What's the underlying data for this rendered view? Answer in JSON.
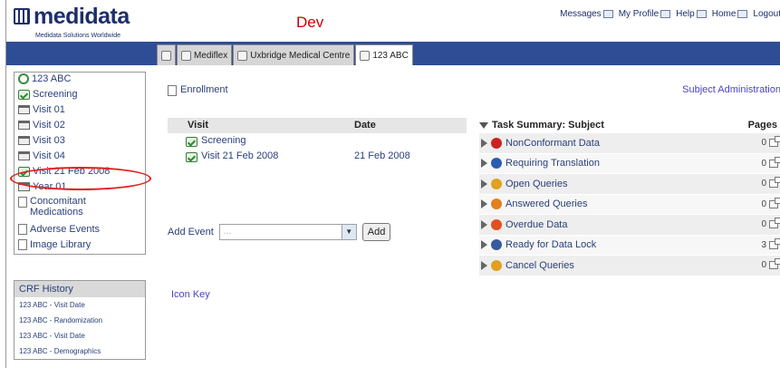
{
  "header": {
    "logo_text": "medidata",
    "logo_tagline": "Medidata Solutions Worldwide",
    "environment": "Dev",
    "links": [
      {
        "label": "Messages",
        "icon": "mail-icon"
      },
      {
        "label": "My Profile",
        "icon": "profile-icon"
      },
      {
        "label": "Help",
        "icon": "help-icon"
      },
      {
        "label": "Home",
        "icon": "home-icon"
      },
      {
        "label": "Logout",
        "icon": "logout-icon"
      }
    ]
  },
  "tabs": [
    {
      "label": "",
      "icon": "home-icon"
    },
    {
      "label": "Mediflex",
      "icon": "study-icon"
    },
    {
      "label": "Uxbridge Medical Centre",
      "icon": "site-icon"
    },
    {
      "label": "123 ABC",
      "icon": "subject-icon",
      "active": true
    }
  ],
  "sidebar": {
    "subject": "123 ABC",
    "items": [
      {
        "label": "Screening",
        "icon": "visit-complete-icon"
      },
      {
        "label": "Visit 01",
        "icon": "folder-icon"
      },
      {
        "label": "Visit 02",
        "icon": "folder-icon"
      },
      {
        "label": "Visit 03",
        "icon": "folder-icon"
      },
      {
        "label": "Visit 04",
        "icon": "folder-icon"
      },
      {
        "label": "Visit 21 Feb 2008",
        "icon": "visit-complete-icon",
        "highlighted": true
      },
      {
        "label": "Year 01",
        "icon": "folder-icon"
      },
      {
        "label": "Concomitant Medications",
        "icon": "document-icon"
      },
      {
        "label": "Adverse Events",
        "icon": "document-icon"
      },
      {
        "label": "Image Library",
        "icon": "document-icon"
      }
    ]
  },
  "crf_history": {
    "title": "CRF History",
    "items": [
      "123 ABC - Visit Date",
      "123 ABC - Randomization",
      "123 ABC - Visit Date",
      "123 ABC - Demographics"
    ]
  },
  "main": {
    "enrollment_link": "Enrollment",
    "subject_admin_link": "Subject Administration",
    "visit_table": {
      "headers": [
        "Visit",
        "Date"
      ],
      "rows": [
        {
          "visit": "Screening",
          "date": ""
        },
        {
          "visit": "Visit 21 Feb 2008",
          "date": "21 Feb 2008"
        }
      ]
    },
    "add_event_label": "Add Event",
    "add_event_placeholder": "...",
    "add_button": "Add",
    "icon_key_link": "Icon Key"
  },
  "task_summary": {
    "title": "Task Summary: Subject",
    "pages_header": "Pages",
    "rows": [
      {
        "label": "NonConformant Data",
        "count": "0",
        "icon": "warning-icon",
        "color": "#cc2222"
      },
      {
        "label": "Requiring Translation",
        "count": "0",
        "icon": "translation-icon",
        "color": "#2a5db0"
      },
      {
        "label": "Open Queries",
        "count": "0",
        "icon": "open-query-icon",
        "color": "#e0a020"
      },
      {
        "label": "Answered Queries",
        "count": "0",
        "icon": "answered-query-icon",
        "color": "#e08020"
      },
      {
        "label": "Overdue Data",
        "count": "0",
        "icon": "overdue-icon",
        "color": "#e05020"
      },
      {
        "label": "Ready for Data Lock",
        "count": "3",
        "icon": "data-lock-icon",
        "color": "#3a5aa0"
      },
      {
        "label": "Cancel Queries",
        "count": "0",
        "icon": "cancel-query-icon",
        "color": "#e0a020"
      }
    ]
  }
}
